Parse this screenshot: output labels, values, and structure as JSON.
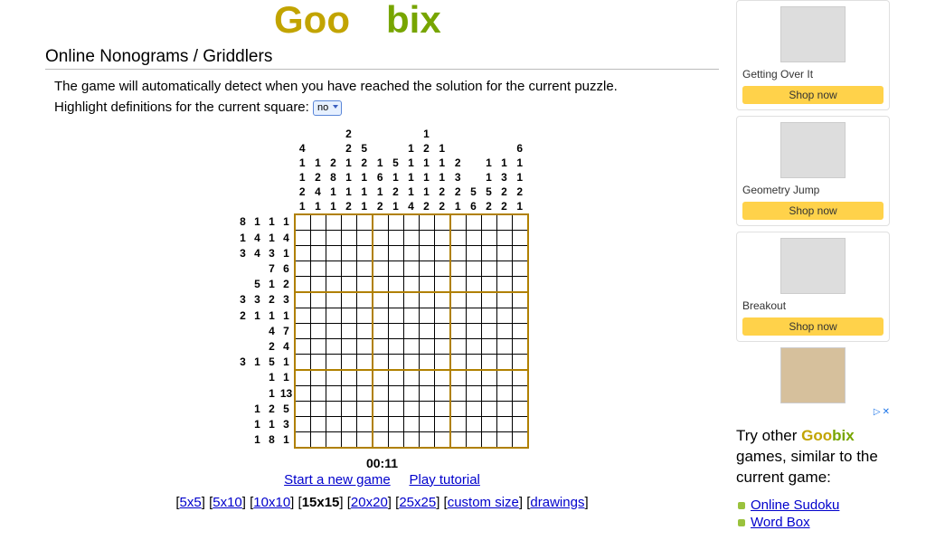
{
  "logo": {
    "part1": "Goo",
    "part2": "bix"
  },
  "page_title": "Online Nonograms / Griddlers",
  "intro": "The game will automatically detect when you have reached the solution for the current puzzle.",
  "highlight_label": "Highlight definitions for the current square: ",
  "highlight_value": "no",
  "timer": "00:11",
  "links": {
    "start": "Start a new game",
    "tutorial": "Play tutorial"
  },
  "sizes": {
    "items": [
      "5x5",
      "5x10",
      "10x10",
      "15x15",
      "20x20",
      "25x25",
      "custom size",
      "drawings"
    ],
    "current": "15x15"
  },
  "clues": {
    "cols": [
      [
        4,
        1,
        1,
        2,
        1
      ],
      [
        1,
        2,
        4,
        1
      ],
      [
        2,
        8,
        1,
        1
      ],
      [
        2,
        2,
        1,
        1,
        1,
        2
      ],
      [
        5,
        2,
        1,
        1,
        1
      ],
      [
        1,
        6,
        1,
        2
      ],
      [
        5,
        1,
        2,
        1
      ],
      [
        1,
        1,
        1,
        1,
        4
      ],
      [
        1,
        2,
        1,
        1,
        1,
        2
      ],
      [
        1,
        1,
        1,
        2,
        2
      ],
      [
        2,
        3,
        2,
        1
      ],
      [
        5,
        6
      ],
      [
        1,
        1,
        5,
        2
      ],
      [
        1,
        3,
        2,
        2
      ],
      [
        6,
        1,
        1,
        2,
        1
      ]
    ],
    "rows": [
      [
        8,
        1,
        1,
        1
      ],
      [
        1,
        4,
        1,
        4
      ],
      [
        3,
        4,
        3,
        1
      ],
      [
        7,
        6
      ],
      [
        5,
        1,
        2
      ],
      [
        3,
        3,
        2,
        3
      ],
      [
        2,
        1,
        1,
        1
      ],
      [
        4,
        7
      ],
      [
        2,
        4
      ],
      [
        3,
        1,
        5,
        1
      ],
      [
        1,
        1
      ],
      [
        1,
        13
      ],
      [
        1,
        2,
        5
      ],
      [
        1,
        1,
        3
      ],
      [
        1,
        8,
        1
      ]
    ]
  },
  "ads": [
    {
      "title": "Getting Over It",
      "btn": "Shop now"
    },
    {
      "title": "Geometry Jump",
      "btn": "Shop now"
    },
    {
      "title": "Breakout",
      "btn": "Shop now"
    }
  ],
  "adchoices": {
    "icon": "▷",
    "x": "✕"
  },
  "try_text": {
    "prefix": "Try other ",
    "suffix": " games, similar to the current game:"
  },
  "related": [
    "Online Sudoku",
    "Word Box"
  ]
}
